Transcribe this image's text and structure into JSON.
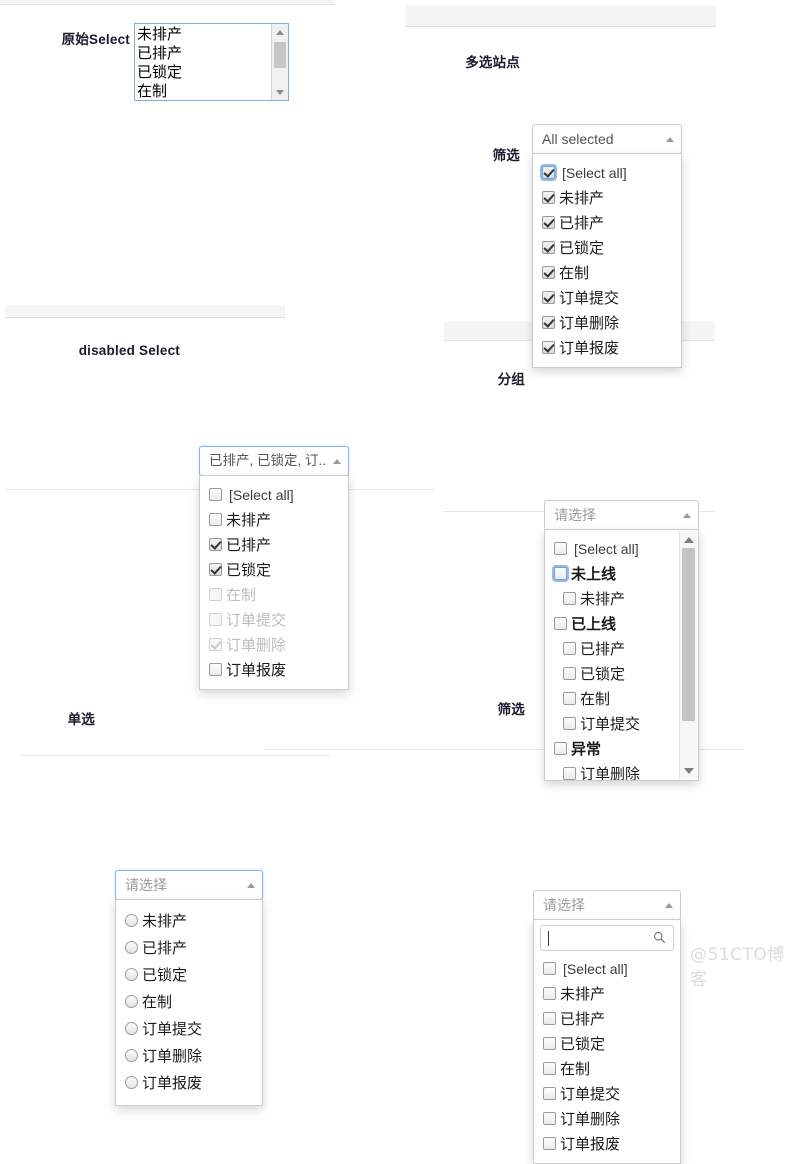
{
  "watermark": "@51CTO博客",
  "blocks": {
    "native": {
      "label": "原始Select",
      "options": [
        "未排产",
        "已排产",
        "已锁定",
        "在制"
      ]
    },
    "multi_site": {
      "label": "多选站点",
      "secondary_label": "筛选",
      "toggle_value": "All selected",
      "select_all_label": "[Select all]",
      "items": [
        {
          "label": "[Select all]",
          "checked": true,
          "latin": true,
          "focus": true
        },
        {
          "label": "未排产",
          "checked": true
        },
        {
          "label": "已排产",
          "checked": true
        },
        {
          "label": "已锁定",
          "checked": true
        },
        {
          "label": "在制",
          "checked": true
        },
        {
          "label": "订单提交",
          "checked": true
        },
        {
          "label": "订单删除",
          "checked": true
        },
        {
          "label": "订单报废",
          "checked": true
        }
      ]
    },
    "disabled_select": {
      "label": "disabled Select",
      "toggle_value": "已排产, 已锁定, 订..",
      "items": [
        {
          "label": "[Select all]",
          "checked": false,
          "latin": true
        },
        {
          "label": "未排产",
          "checked": false
        },
        {
          "label": "已排产",
          "checked": true
        },
        {
          "label": "已锁定",
          "checked": true
        },
        {
          "label": "在制",
          "checked": false,
          "disabled": true
        },
        {
          "label": "订单提交",
          "checked": false,
          "disabled": true
        },
        {
          "label": "订单删除",
          "checked": true,
          "disabled": true
        },
        {
          "label": "订单报废",
          "checked": false
        }
      ]
    },
    "group_select": {
      "label": "分组",
      "toggle_value": "请选择",
      "items": [
        {
          "label": "[Select all]",
          "checked": false,
          "latin": true
        },
        {
          "label": "未上线",
          "checked": false,
          "group": true,
          "focus": true
        },
        {
          "label": "未排产",
          "checked": false,
          "indent": true
        },
        {
          "label": "已上线",
          "checked": false,
          "group": true
        },
        {
          "label": "已排产",
          "checked": false,
          "indent": true
        },
        {
          "label": "已锁定",
          "checked": false,
          "indent": true
        },
        {
          "label": "在制",
          "checked": false,
          "indent": true
        },
        {
          "label": "订单提交",
          "checked": false,
          "indent": true
        },
        {
          "label": "异常",
          "checked": false,
          "group": true
        },
        {
          "label": "订单删除",
          "checked": false,
          "indent": true
        }
      ]
    },
    "single_select": {
      "label": "单选",
      "toggle_value": "请选择",
      "items": [
        {
          "label": "未排产"
        },
        {
          "label": "已排产"
        },
        {
          "label": "已锁定"
        },
        {
          "label": "在制"
        },
        {
          "label": "订单提交"
        },
        {
          "label": "订单删除"
        },
        {
          "label": "订单报废"
        }
      ]
    },
    "filter_select": {
      "label": "筛选",
      "toggle_value": "请选择",
      "search_value": "",
      "search_placeholder": "",
      "items": [
        {
          "label": "[Select all]",
          "checked": false,
          "latin": true
        },
        {
          "label": "未排产",
          "checked": false
        },
        {
          "label": "已排产",
          "checked": false
        },
        {
          "label": "已锁定",
          "checked": false
        },
        {
          "label": "在制",
          "checked": false
        },
        {
          "label": "订单提交",
          "checked": false
        },
        {
          "label": "订单删除",
          "checked": false
        },
        {
          "label": "订单报废",
          "checked": false
        }
      ]
    }
  },
  "colors": {
    "panel": "#f5f5f5",
    "border": "#cccccc",
    "focus": "#8ab4e8",
    "label": "#1a1a2e"
  }
}
